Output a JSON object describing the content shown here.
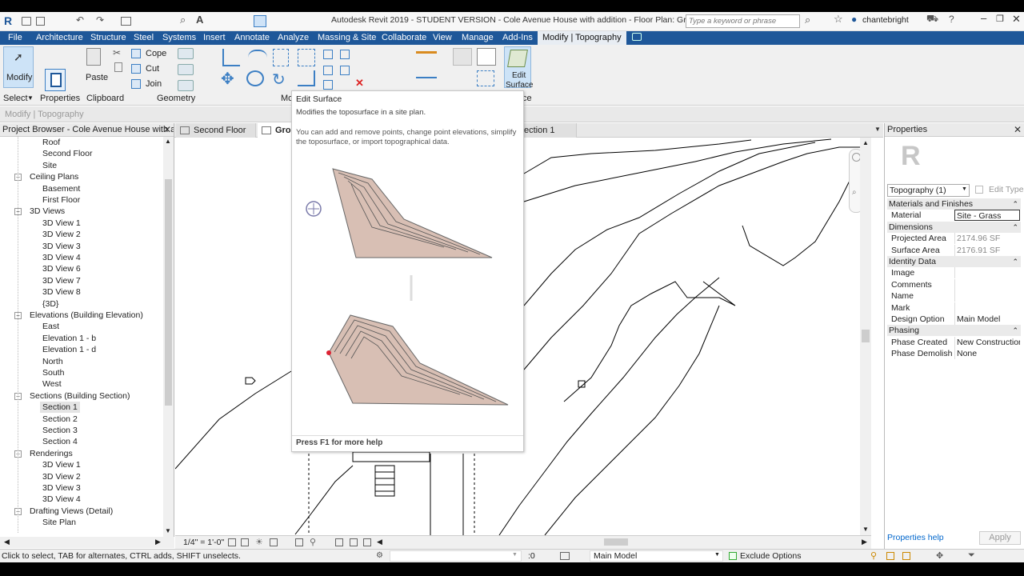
{
  "app": {
    "title": "Autodesk Revit 2019 - STUDENT VERSION - Cole Avenue House with addition - Floor Plan: Ground",
    "search_placeholder": "Type a keyword or phrase",
    "user": "chantebright"
  },
  "ribbon_tabs": [
    "File",
    "Architecture",
    "Structure",
    "Steel",
    "Systems",
    "Insert",
    "Annotate",
    "Analyze",
    "Massing & Site",
    "Collaborate",
    "View",
    "Manage",
    "Add-Ins",
    "Modify | Topography"
  ],
  "ribbon": {
    "modify": "Modify",
    "paste": "Paste",
    "cope": "Cope",
    "cut": "Cut",
    "join": "Join",
    "edit_surface_line1": "Edit",
    "edit_surface_line2": "Surface",
    "panels": {
      "select": "Select",
      "properties": "Properties",
      "clipboard": "Clipboard",
      "geometry": "Geometry",
      "modify_trunc": "Mo",
      "surface_trunc": "ce"
    }
  },
  "context_bar": "Modify | Topography",
  "project_browser": {
    "title": "Project Browser - Cole Avenue House with ad...",
    "items": [
      {
        "label": "Roof",
        "level": 2
      },
      {
        "label": "Second Floor",
        "level": 2
      },
      {
        "label": "Site",
        "level": 2
      },
      {
        "label": "Ceiling Plans",
        "level": 1
      },
      {
        "label": "Basement",
        "level": 2
      },
      {
        "label": "First Floor",
        "level": 2
      },
      {
        "label": "3D Views",
        "level": 1
      },
      {
        "label": "3D View 1",
        "level": 2
      },
      {
        "label": "3D View 2",
        "level": 2
      },
      {
        "label": "3D View 3",
        "level": 2
      },
      {
        "label": "3D View 4",
        "level": 2
      },
      {
        "label": "3D View 6",
        "level": 2
      },
      {
        "label": "3D View 7",
        "level": 2
      },
      {
        "label": "3D View 8",
        "level": 2
      },
      {
        "label": "{3D}",
        "level": 2
      },
      {
        "label": "Elevations (Building Elevation)",
        "level": 1
      },
      {
        "label": "East",
        "level": 2
      },
      {
        "label": "Elevation 1 - b",
        "level": 2
      },
      {
        "label": "Elevation 1 - d",
        "level": 2
      },
      {
        "label": "North",
        "level": 2
      },
      {
        "label": "South",
        "level": 2
      },
      {
        "label": "West",
        "level": 2
      },
      {
        "label": "Sections (Building Section)",
        "level": 1
      },
      {
        "label": "Section 1",
        "level": 2
      },
      {
        "label": "Section 2",
        "level": 2
      },
      {
        "label": "Section 3",
        "level": 2
      },
      {
        "label": "Section 4",
        "level": 2
      },
      {
        "label": "Renderings",
        "level": 1
      },
      {
        "label": "3D View 1",
        "level": 2
      },
      {
        "label": "3D View 2",
        "level": 2
      },
      {
        "label": "3D View 3",
        "level": 2
      },
      {
        "label": "3D View 4",
        "level": 2
      },
      {
        "label": "Drafting Views (Detail)",
        "level": 1
      },
      {
        "label": "Site Plan",
        "level": 2
      }
    ]
  },
  "view_tabs": [
    "Second Floor",
    "Grou",
    "ection 1"
  ],
  "tooltip": {
    "title": "Edit Surface",
    "desc": "Modifies the toposurface in a site plan.",
    "detail": "You can add and remove points, change point elevations, simplify the toposurface, or import topographical data.",
    "help": "Press F1 for more help"
  },
  "view_scale": "1/4\" = 1'-0\"",
  "properties": {
    "title": "Properties",
    "type_selector": "Topography (1)",
    "edit_type": "Edit Type",
    "sections": [
      {
        "name": "Materials and Finishes",
        "rows": [
          {
            "k": "Material",
            "v": "Site - Grass"
          }
        ]
      },
      {
        "name": "Dimensions",
        "rows": [
          {
            "k": "Projected Area",
            "v": "2174.96 SF"
          },
          {
            "k": "Surface Area",
            "v": "2176.91 SF"
          }
        ]
      },
      {
        "name": "Identity Data",
        "rows": [
          {
            "k": "Image",
            "v": ""
          },
          {
            "k": "Comments",
            "v": ""
          },
          {
            "k": "Name",
            "v": ""
          },
          {
            "k": "Mark",
            "v": ""
          },
          {
            "k": "Design Option",
            "v": "Main Model"
          }
        ]
      },
      {
        "name": "Phasing",
        "rows": [
          {
            "k": "Phase Created",
            "v": "New Construction"
          },
          {
            "k": "Phase Demolish...",
            "v": "None"
          }
        ]
      }
    ],
    "help": "Properties help",
    "apply": "Apply"
  },
  "status": {
    "text": "Click to select, TAB for alternates, CTRL adds, SHIFT unselects.",
    "zero": ":0",
    "model": "Main Model",
    "exclude": "Exclude Options"
  },
  "colors": {
    "ribbon_blue": "#1e5799",
    "accent": "#0066cc"
  }
}
